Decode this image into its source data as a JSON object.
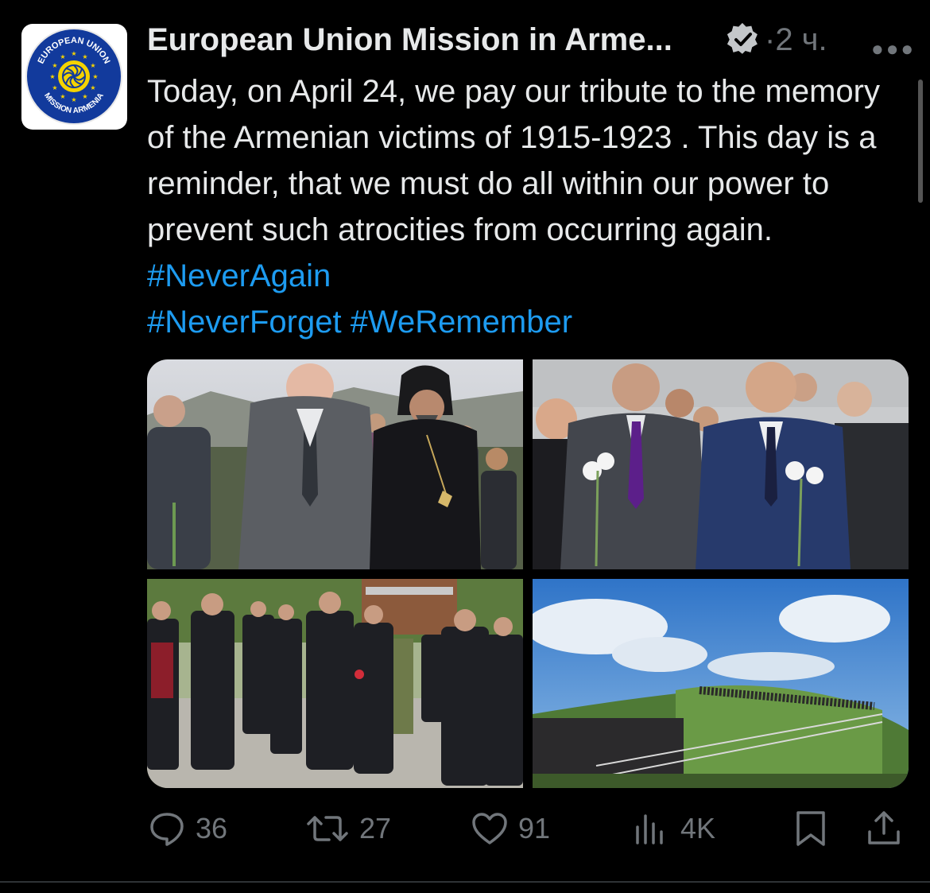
{
  "account": {
    "name": "European Union Mission in Arme...",
    "avatar_text_top": "EUROPEAN UNION",
    "avatar_text_bottom": "MISSION ARMENIA"
  },
  "tweet": {
    "time": "·2 ч.",
    "text": "Today, on April 24, we pay our tribute to the memory of the Armenian victims of 1915-1923 . This day is a reminder, that we must do all within our power to prevent such atrocities from occurring again. ",
    "hashtags": [
      "#NeverAgain",
      "#NeverForget",
      "#WeRemember"
    ]
  },
  "media": {
    "photos": [
      {
        "label": "officials-and-clergy-photo"
      },
      {
        "label": "officials-with-flowers-photo"
      },
      {
        "label": "procession-photo"
      },
      {
        "label": "hill-memorial-photo"
      }
    ]
  },
  "actions": {
    "replies": "36",
    "reposts": "27",
    "likes": "91",
    "views": "4K"
  },
  "icons": {
    "verified": "verified-badge-icon",
    "more": "more-options-icon",
    "reply": "reply-icon",
    "repost": "repost-icon",
    "like": "heart-icon",
    "views": "views-icon",
    "bookmark": "bookmark-icon",
    "share": "share-icon"
  },
  "colors": {
    "background": "#000000",
    "text": "#e7e9ea",
    "secondary": "#71767b",
    "link": "#1d9bf0",
    "eu_blue": "#123a9c",
    "eu_gold": "#f5d300"
  }
}
